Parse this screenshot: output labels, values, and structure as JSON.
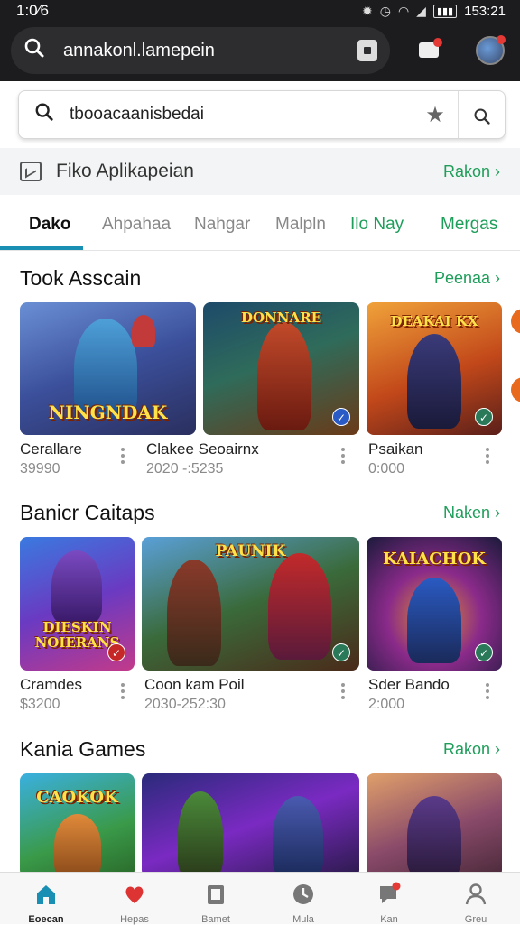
{
  "status": {
    "time_left": "1:0⁄6",
    "time_right": "153:21",
    "battery": ""
  },
  "browser": {
    "url": "annakonl.lamepein"
  },
  "search": {
    "query": "tbooacaanisbedai"
  },
  "strip": {
    "title": "Fiko Aplikapeian",
    "more": "Rakon ›"
  },
  "categories": [
    {
      "label": "Dako",
      "state": "active"
    },
    {
      "label": "Ahpahaa",
      "state": "normal"
    },
    {
      "label": "Nahgar",
      "state": "normal"
    },
    {
      "label": "Malpln",
      "state": "normal"
    },
    {
      "label": "Ilo Nay",
      "state": "green"
    },
    {
      "label": "Mergas",
      "state": "green"
    }
  ],
  "sections": [
    {
      "title": "Took Asscain",
      "more": "Peenaa ›",
      "items": [
        {
          "name": "Cerallare",
          "meta": "39990",
          "art": "NINGNDAK"
        },
        {
          "name": "Clakee Seoairnx",
          "meta": "2020 -:5235",
          "art": "DONNARE"
        },
        {
          "name": "Psaikan",
          "meta": "0:000",
          "art": "DEAKAI KX"
        }
      ]
    },
    {
      "title": "Banicr Caitaps",
      "more": "Naken ›",
      "items": [
        {
          "name": "Cramdes",
          "meta": "$3200",
          "art": "DIESKIN NOIERANS"
        },
        {
          "name": "Coon kam Poil",
          "meta": "2030-252:30",
          "art": "PAUNIK"
        },
        {
          "name": "Sder Bando",
          "meta": "2:000",
          "art": "KAIACHOK"
        }
      ]
    },
    {
      "title": "Kania Games",
      "more": "Rakon ›",
      "items": [
        {
          "art": "CAOKOK"
        },
        {
          "art": ""
        },
        {
          "art": ""
        }
      ]
    }
  ],
  "nav": [
    "Eoecan",
    "Hepas",
    "Bamet",
    "Mula",
    "Kan",
    "Greu"
  ],
  "colors": {
    "accent_green": "#1e9e5a",
    "tab_underline": "#1a8fb4"
  }
}
